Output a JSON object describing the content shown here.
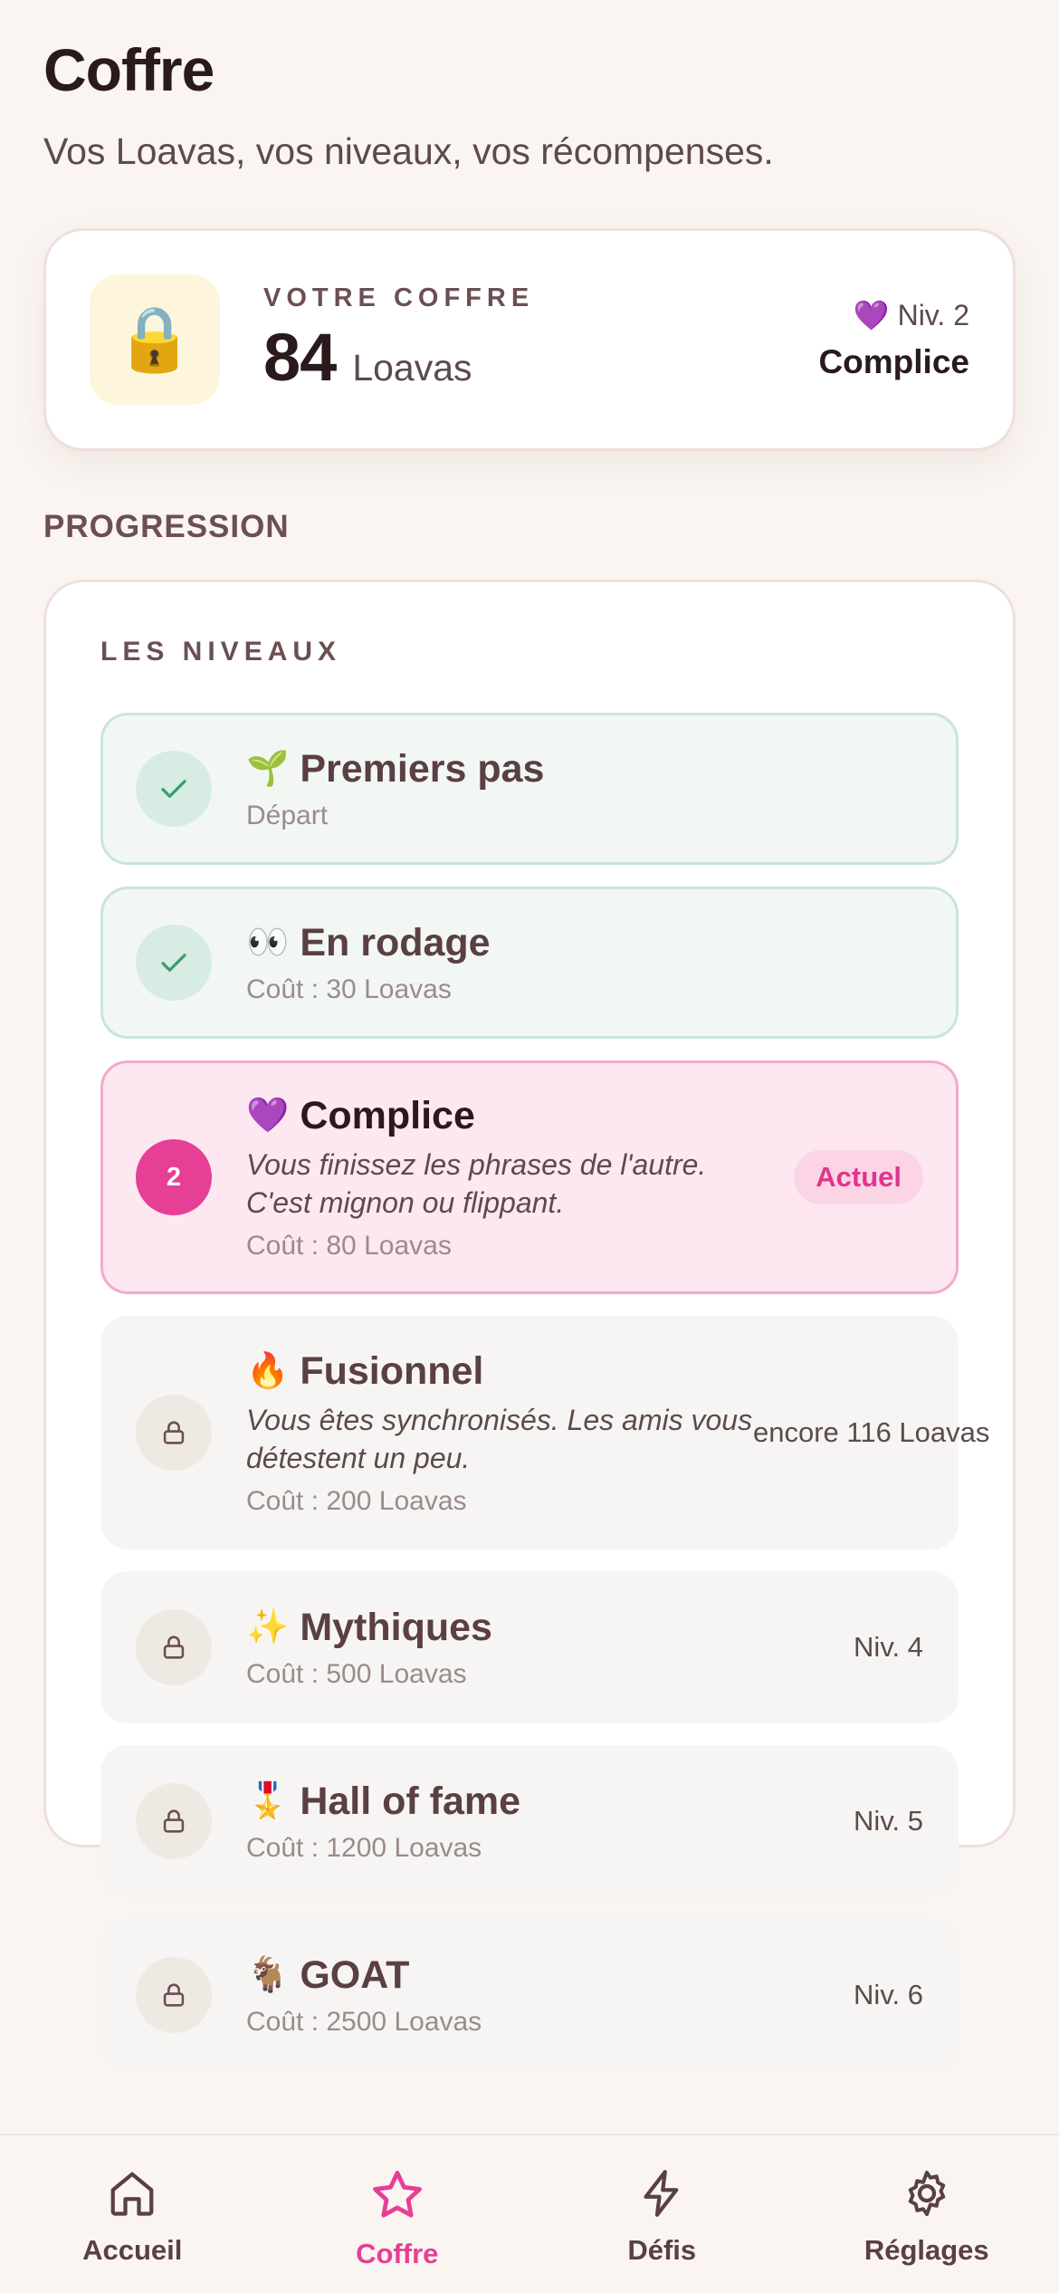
{
  "header": {
    "title": "Coffre",
    "subtitle": "Vos Loavas, vos niveaux, vos récompenses."
  },
  "vault": {
    "icon": "🔒",
    "label": "VOTRE COFFRE",
    "amount": "84",
    "unit": "Loavas",
    "level_line": "💜 Niv. 2",
    "level_name": "Complice"
  },
  "progression": {
    "section_title": "PROGRESSION",
    "card_label": "LES NIVEAUX",
    "levels": [
      {
        "emoji": "🌱",
        "name": "Premiers pas",
        "cost": "Départ",
        "right": ""
      },
      {
        "emoji": "👀",
        "name": "En rodage",
        "cost": "Coût : 30 Loavas",
        "right": ""
      },
      {
        "emoji": "💜",
        "name": "Complice",
        "marker": "2",
        "desc": "Vous finissez les phrases de l'autre. C'est mignon ou flippant.",
        "cost": "Coût : 80 Loavas",
        "right": "Actuel"
      },
      {
        "emoji": "🔥",
        "name": "Fusionnel",
        "desc": "Vous êtes synchronisés. Les amis vous détestent un peu.",
        "cost": "Coût : 200 Loavas",
        "right": "encore 116 Loavas"
      },
      {
        "emoji": "✨",
        "name": "Mythiques",
        "cost": "Coût : 500 Loavas",
        "right": "Niv. 4"
      },
      {
        "emoji": "🎖️",
        "name": "Hall of fame",
        "cost": "Coût : 1200 Loavas",
        "right": "Niv. 5"
      },
      {
        "emoji": "🐐",
        "name": "GOAT",
        "cost": "Coût : 2500 Loavas",
        "right": "Niv. 6"
      }
    ]
  },
  "tabbar": {
    "tabs": [
      {
        "label": "Accueil",
        "icon": "home-icon"
      },
      {
        "label": "Coffre",
        "icon": "star-icon",
        "active": true
      },
      {
        "label": "Défis",
        "icon": "lightning-icon"
      },
      {
        "label": "Réglages",
        "icon": "gear-icon"
      }
    ]
  },
  "colors": {
    "accent": "#e63f96",
    "background": "#faf5f1",
    "done_bg": "#f2f7f4",
    "current_bg": "#fde8f1"
  }
}
